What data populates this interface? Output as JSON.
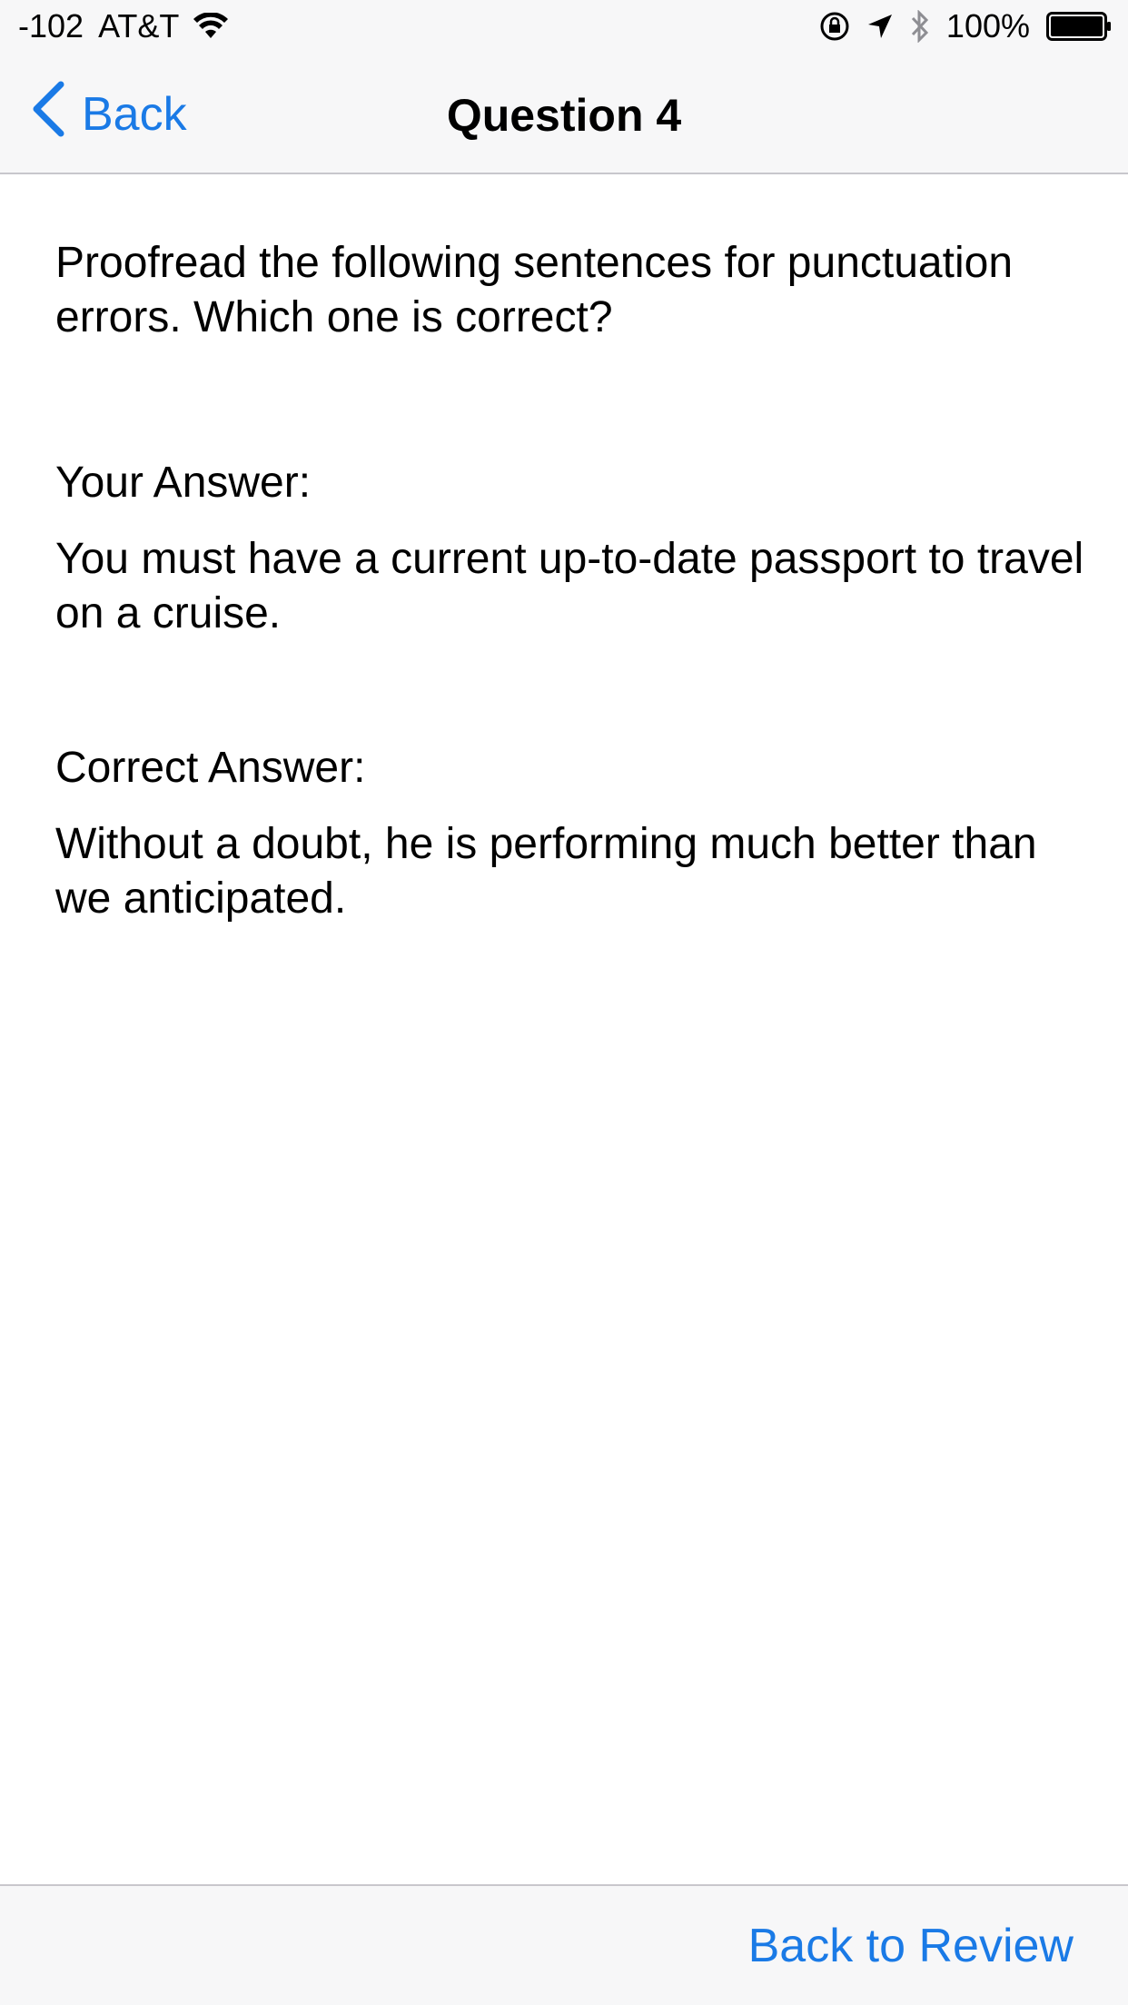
{
  "status_bar": {
    "signal": "-102",
    "carrier": "AT&T",
    "battery_percent": "100%",
    "icons": [
      "wifi-icon",
      "orientation-lock-icon",
      "location-arrow-icon",
      "bluetooth-icon",
      "battery-icon"
    ]
  },
  "nav": {
    "back_label": "Back",
    "title": "Question 4"
  },
  "content": {
    "question": "Proofread the following sentences for punctuation errors. Which one is correct?",
    "your_answer_label": "Your Answer:",
    "your_answer": "You must have a current up-to-date passport to travel on a cruise.",
    "correct_answer_label": "Correct Answer:",
    "correct_answer": "Without a doubt, he is performing much better than we anticipated."
  },
  "toolbar": {
    "back_to_review_label": "Back to Review"
  },
  "colors": {
    "accent": "#1a7ae6",
    "bar_background": "#f7f7f8"
  }
}
